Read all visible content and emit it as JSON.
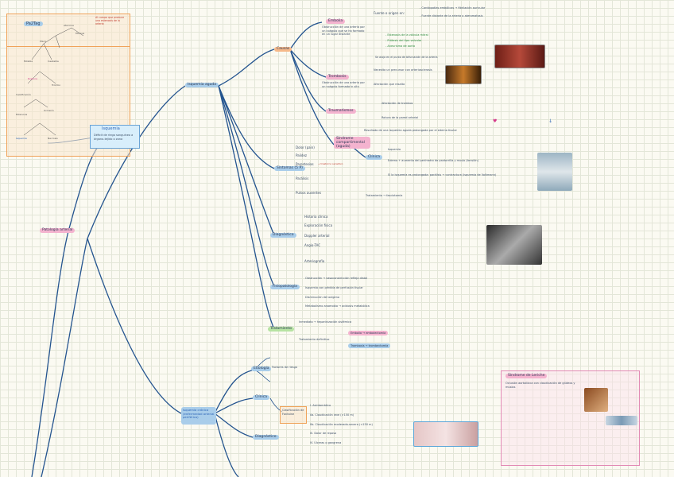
{
  "mindmap": {
    "root": "Patología arterial",
    "branch1": {
      "title": "Isquemia",
      "desc": "Déficit de riego sanguíneo a órgano-tejido o zona"
    },
    "branch2": {
      "title": "Isquemia aguda",
      "causes_title": "Causas",
      "embolia": {
        "title": "Embolia",
        "desc": "Obstrucción de una arteria por un coágulo que se ha formado en un lugar distante",
        "items": [
          "Fuente o origen en:",
          "- Cardiopatías embólicas → fibrilación auricular",
          "- Fuente distante de la arteria o ateromatosis",
          "- Estenosis de la válvula mitral",
          "- Prótesis del tipo valvular",
          "- Aneurisma de aorta",
          "Se aloja en el punto de bifurcación de la arteria"
        ]
      },
      "trombosis": {
        "title": "Trombosis",
        "desc": "Obstrucción de una arteria por un coágulo formado in situ",
        "items": [
          "Necesita un precursor con arteriosclerosis",
          "Afectación que resalta"
        ]
      },
      "traumatismos": {
        "title": "Traumatismos",
        "items": [
          "Afectación de trombos",
          "Rotura de la pared arterial"
        ]
      },
      "sindrome": {
        "title": "Síndrome compartimental (aguda)",
        "desc": "Resultado de una isquemia aguda prolongada por el edema tisular"
      },
      "clinica": {
        "title": "Clínica",
        "items": [
          "Isquemia",
          "Edema + aumento del perímetro de pantorrilla y muslo (tensión)",
          "Si la isquemia es prolongada: parálisis → contractura (isquemia de Volkmann)",
          "Tratamiento → fasciotomía"
        ]
      },
      "cinco_p": {
        "title": "Síntomas (5 P)",
        "items": [
          "Dolor (pain)",
          "Palidez",
          "Parestesias",
          "Parálisis",
          "Pulsos ausentes"
        ]
      },
      "diagnostico": {
        "title": "Diagnóstico",
        "items": [
          "Historia clínica",
          "Exploración física",
          "Doppler arterial",
          "Angio-TAC",
          "Arteriografía"
        ]
      },
      "fisiopatologia": {
        "title": "Fisiopatología",
        "items": [
          "Obstrucción → vasoconstricción refleja distal",
          "Isquemia con pérdida de perfusión tisular",
          "Disminución del oxígeno",
          "Metabolismo anaerobio → acidosis metabólica"
        ]
      },
      "tratamiento": {
        "title": "Tratamiento",
        "items": [
          "Inmediato → heparinización sistémica",
          "Tratamiento definitivo",
          "Embolia → embolectomía",
          "Trombosis → trombectomía"
        ]
      }
    },
    "branch3": {
      "title": "Isquemia crónica (enfermedad arterial periférica)",
      "factors": "Factores de riesgo",
      "clasif": "Clasificación de Fontaine",
      "fontaine": [
        "I. Asintomático",
        "IIa. Claudicación leve (>150 m)",
        "IIb. Claudicación moderada-severa (<150 m)",
        "III. Dolor de reposo",
        "IV. Úlceras o gangrena"
      ],
      "etiologia": "Etiología",
      "clinica": "Clínica",
      "diagnostico": "Diagnóstico"
    },
    "sidebox": {
      "title": "Pa2Tag",
      "note": "Anotaciones"
    },
    "callout": {
      "title": "Síndrome de Leriche",
      "text": "Oclusión aortoilíaca con claudicación de glúteos y muslos"
    }
  }
}
